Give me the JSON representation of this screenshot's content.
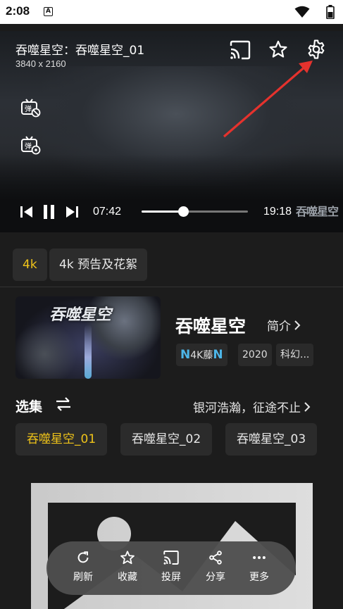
{
  "status_bar": {
    "time": "2:08",
    "notification_icon": "A"
  },
  "player": {
    "title": "吞噬星空：吞噬星空_01",
    "resolution": "3840 x 2160",
    "current_time": "07:42",
    "duration": "19:18",
    "progress_fraction": 0.39,
    "watermark": "吞噬星空",
    "icons": [
      "cast-icon",
      "star-icon",
      "settings-icon",
      "danmaku-off-icon",
      "danmaku-settings-icon",
      "skip-previous-icon",
      "pause-icon",
      "skip-next-icon"
    ]
  },
  "source_chips": [
    {
      "label": "4k",
      "active": true
    },
    {
      "label": "4k 预告及花絮",
      "active": false
    }
  ],
  "show": {
    "poster_title": "吞噬星空",
    "title": "吞噬星空",
    "intro_label": "简介",
    "tags": {
      "source": "4K藤",
      "year": "2020",
      "genre": "科幻..."
    }
  },
  "episodes": {
    "section_title": "选集",
    "subtitle": "银河浩瀚，征途不止",
    "items": [
      {
        "label": "吞噬星空_01",
        "active": true
      },
      {
        "label": "吞噬星空_02",
        "active": false
      },
      {
        "label": "吞噬星空_03",
        "active": false
      }
    ]
  },
  "bottom_bar": {
    "refresh": "刷新",
    "favorite": "收藏",
    "cast": "投屏",
    "share": "分享",
    "more": "更多"
  },
  "colors": {
    "accent": "#f0c419",
    "tag_blue": "#4db6e8"
  }
}
